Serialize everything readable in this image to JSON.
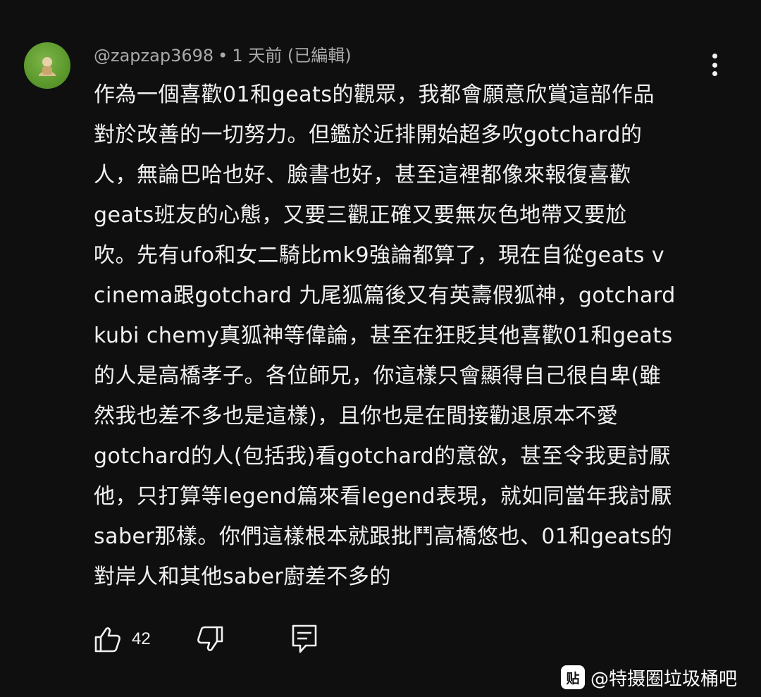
{
  "comment": {
    "author": "@zapzap3698",
    "separator": "•",
    "time": "1 天前",
    "edited": "(已編輯)",
    "lines": [
      "作為一個喜歡01和geats的觀眾，我都會願意欣賞這部作品",
      "對於改善的一切努力。但鑑於近排開始超多吹gotchard的",
      "人，無論巴哈也好、臉書也好，甚至這裡都像來報復喜歡",
      "geats班友的心態，又要三觀正確又要無灰色地帶又要尬",
      "吹。先有ufo和女二騎比mk9強論都算了，現在自從geats v",
      "cinema跟gotchard 九尾狐篇後又有英壽假狐神，gotchard",
      "kubi chemy真狐神等偉論，甚至在狂貶其他喜歡01和geats",
      "的人是高橋孝子。各位師兄，你這樣只會顯得自己很自卑(雖",
      "然我也差不多也是這樣)，且你也是在間接勸退原本不愛",
      "gotchard的人(包括我)看gotchard的意欲，甚至令我更討厭",
      "他，只打算等legend篇來看legend表現，就如同當年我討厭",
      "saber那樣。你們這樣根本就跟批鬥高橋悠也、01和geats的",
      "對岸人和其他saber廚差不多的"
    ],
    "like_count": "42"
  },
  "icons": {
    "avatar": "avatar-figure-icon",
    "more": "more-vertical-icon",
    "like": "thumbs-up-icon",
    "dislike": "thumbs-down-icon",
    "reply": "comment-reply-icon"
  },
  "watermark": {
    "logo": "贴",
    "text": "@特摄圈垃圾桶吧"
  },
  "colors": {
    "background": "#0f0f0f",
    "text_primary": "#f1f1f1",
    "text_secondary": "#aaaaaa",
    "avatar_green": "#5e9b2e"
  }
}
